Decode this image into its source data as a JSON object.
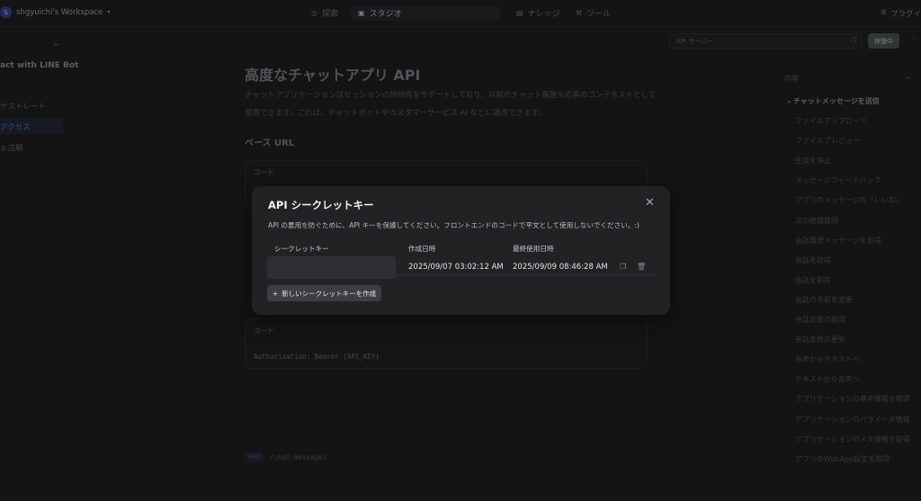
{
  "topbar": {
    "workspace_initial": "S",
    "workspace_name": "shgyuichi's Workspace",
    "nav": [
      "探索",
      "スタジオ",
      "ナレッジ",
      "ツール"
    ],
    "plugin_label": "プラグイ"
  },
  "sidebar": {
    "app_title": "act with LINE Bot",
    "items": [
      "ケストレート",
      "アクセス",
      "ぉ注解"
    ]
  },
  "api_search": {
    "placeholder": "API サーバー"
  },
  "status_button": "稼働中",
  "main": {
    "title": "高度なチャットアプリ API",
    "description": "チャットアプリケーションはセッションの持続性をサポートしており、以前のチャット履歴を応答のコンテキストとして使用できます。これは、チャットボットやカスタマーサービス AI などに適用できます。",
    "base_url_heading": "ベース URL",
    "code_label_1": "コード",
    "code_label_2": "コード",
    "auth_code": "Authorization: Bearer {API_KEY}",
    "method_tag": "POST",
    "endpoint_path": "/chat-messages"
  },
  "toc": {
    "heading": "内容",
    "items": [
      "チャットメッセージを送信",
      "ファイルアップロード",
      "ファイルプレビュー",
      "生成を停止",
      "メッセージフィードバック",
      "アプリのメッセージの「いいね」",
      "次の推奨質問",
      "会話履歴メッセージを取得",
      "会話を取得",
      "会話を削除",
      "会話の名前を変更",
      "会話変数の取得",
      "会話変数の更新",
      "音声からテキストへ",
      "テキストから音声へ",
      "アプリケーションの基本情報を取得",
      "アプリケーションのパラメータ情報",
      "アプリケーションのメタ情報を取得",
      "アプリのWebApp設定を取得"
    ]
  },
  "modal": {
    "title": "API シークレットキー",
    "description": "API の悪用を防ぐために、API キーを保護してください。フロントエンドのコードで平文として使用しないでください。:)",
    "col_secret_key": "シークレットキー",
    "col_created": "作成日時",
    "col_last_used": "最終使用日時",
    "rows": [
      {
        "created": "2025/09/07 03:02:12 AM",
        "last_used": "2025/09/09 08:46:28 AM"
      }
    ],
    "add_button": "新しいシークレットキーを作成"
  }
}
